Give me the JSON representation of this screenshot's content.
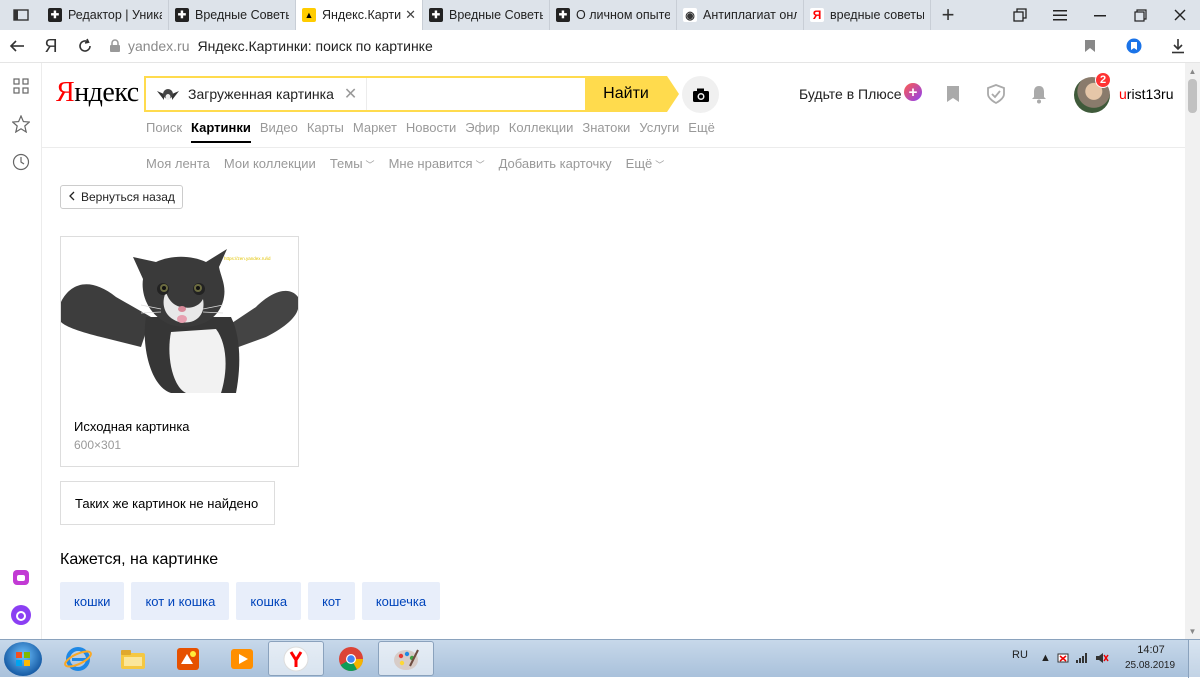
{
  "tabs": [
    {
      "label": "Редактор | Уникал",
      "icon": "zen-icon",
      "active": false
    },
    {
      "label": "Вредные Советы",
      "icon": "zen-icon",
      "active": false
    },
    {
      "label": "Яндекс.Картин",
      "icon": "yandex-images-icon",
      "active": true
    },
    {
      "label": "Вредные Советы",
      "icon": "zen-icon",
      "active": false
    },
    {
      "label": "О личном опыте",
      "icon": "zen-icon",
      "active": false
    },
    {
      "label": "Антиплагиат онла",
      "icon": "eye-icon",
      "active": false
    },
    {
      "label": "вредные советы с",
      "icon": "yandex-icon",
      "active": false
    }
  ],
  "address": {
    "domain": "yandex.ru",
    "title": "Яндекс.Картинки: поиск по картинке",
    "ya_label": "Я"
  },
  "header": {
    "logo_first": "Я",
    "logo_rest": "ндекс",
    "search_chip_label": "Загруженная картинка",
    "search_button": "Найти",
    "plus_text": "Будьте в Плюсе",
    "avatar_badge": "2",
    "username_first": "u",
    "username_rest": "rist13ru"
  },
  "services": [
    {
      "label": "Поиск",
      "active": false
    },
    {
      "label": "Картинки",
      "active": true
    },
    {
      "label": "Видео",
      "active": false
    },
    {
      "label": "Карты",
      "active": false
    },
    {
      "label": "Маркет",
      "active": false
    },
    {
      "label": "Новости",
      "active": false
    },
    {
      "label": "Эфир",
      "active": false
    },
    {
      "label": "Коллекции",
      "active": false
    },
    {
      "label": "Знатоки",
      "active": false
    },
    {
      "label": "Услуги",
      "active": false
    },
    {
      "label": "Ещё",
      "active": false
    }
  ],
  "subnav": [
    {
      "label": "Моя лента",
      "dropdown": false
    },
    {
      "label": "Мои коллекции",
      "dropdown": false
    },
    {
      "label": "Темы",
      "dropdown": true
    },
    {
      "label": "Мне нравится",
      "dropdown": true
    },
    {
      "label": "Добавить карточку",
      "dropdown": false
    },
    {
      "label": "Ещё",
      "dropdown": true
    }
  ],
  "main": {
    "back_button": "Вернуться назад",
    "card_title": "Исходная картинка",
    "card_size": "600×301",
    "watermark": "https://zen.yandex.ru/id",
    "not_found": "Таких же картинок не найдено",
    "tags_title": "Кажется, на картинке",
    "tags": [
      "кошки",
      "кот и кошка",
      "кошка",
      "кот",
      "кошечка"
    ]
  },
  "taskbar": {
    "lang": "RU",
    "time": "14:07",
    "date": "25.08.2019"
  },
  "colors": {
    "brand_yellow": "#ffdb4d",
    "brand_red": "#ff0000",
    "tag_bg": "#e8eefa",
    "tag_text": "#0044bb"
  }
}
